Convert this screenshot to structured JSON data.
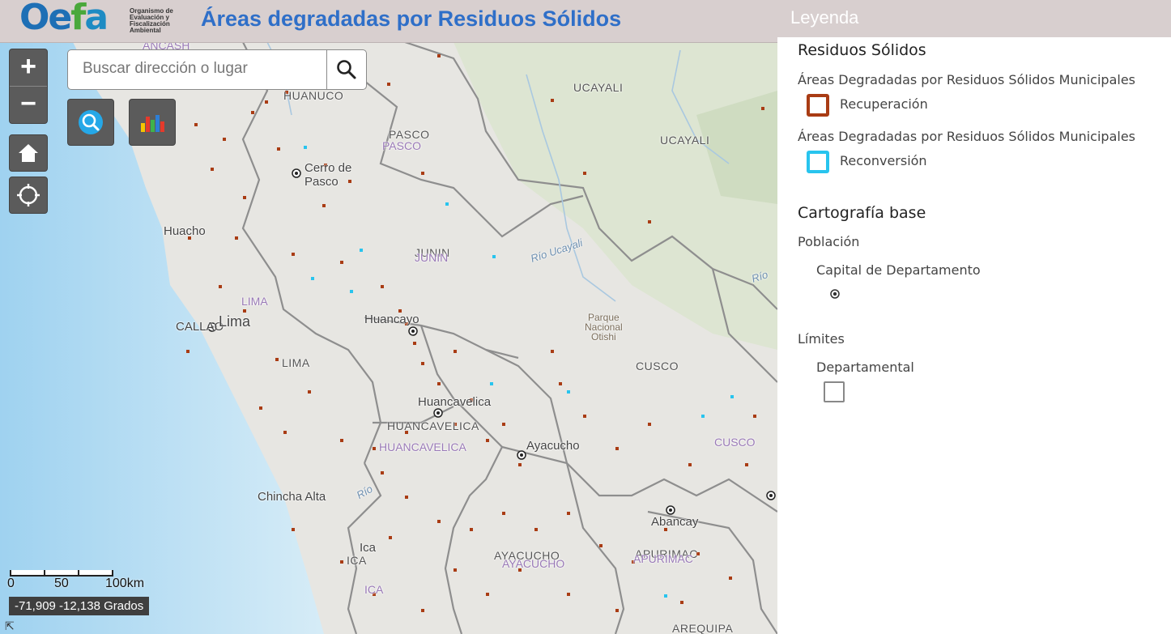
{
  "header": {
    "logo": {
      "text_o": "O",
      "text_e": "e",
      "text_f": "f",
      "text_a": "a",
      "subtitle": "Organismo de Evaluación y Fiscalización Ambiental"
    },
    "title": "Áreas degradadas por Residuos Sólidos"
  },
  "map": {
    "search": {
      "placeholder": "Buscar dirección o lugar"
    },
    "zoom_in": "+",
    "zoom_out": "−",
    "labels": {
      "huanuco": "HUANUCO",
      "ancash": "ANCASH",
      "pasco": "PASCO",
      "pasco2": "PASCO",
      "ucayali1": "UCAYALI",
      "ucayali2": "UCAYALI",
      "cerro1": "Cerro de",
      "cerro2": "Pasco",
      "huacho": "Huacho",
      "junin": "JUNIN",
      "junin2": "JUNIN",
      "rio_ucayali": "Río Ucayali",
      "rio": "Río",
      "lima_p": "LIMA",
      "callao": "CALLAO",
      "lima": "Lima",
      "huancayo": "Huancayo",
      "park1": "Parque",
      "park2": "Nacional",
      "park3": "Otishi",
      "lima2": "LIMA",
      "cusco": "CUSCO",
      "huancavelica_c": "Huancavelica",
      "huancavelica": "HUANCAVELICA",
      "huancavelica2": "HUANCAVELICA",
      "ayacucho_c": "Ayacucho",
      "cusco2": "CUSCO",
      "chincha": "Chincha Alta",
      "rio2": "Río",
      "abancay": "Abancay",
      "ica_c": "Ica",
      "ica": "ICA",
      "ica2": "ICA",
      "ayacucho": "AYACUCHO",
      "ayacucho2": "AYACUCHO",
      "apurimac": "APURIMAC",
      "apurimac2": "APURIMAC",
      "arequipa": "AREQUIPA"
    },
    "scale": {
      "l0": "0",
      "l50": "50",
      "l100": "100km"
    },
    "coords": "-71,909 -12,138 Grados",
    "colors": {
      "recuperacion": "#a93c14",
      "reconversion": "#28c4ee"
    }
  },
  "legend": {
    "title": "Leyenda",
    "group1": "Residuos Sólidos",
    "layer1": "Áreas Degradadas por Residuos Sólidos Municipales",
    "item1": "Recuperación",
    "layer2": "Áreas Degradadas por Residuos Sólidos Municipales",
    "item2": "Reconversión",
    "group2": "Cartografía base",
    "poblacion": "Población",
    "capital": "Capital de Departamento",
    "limites": "Límites",
    "departamental": "Departamental"
  }
}
